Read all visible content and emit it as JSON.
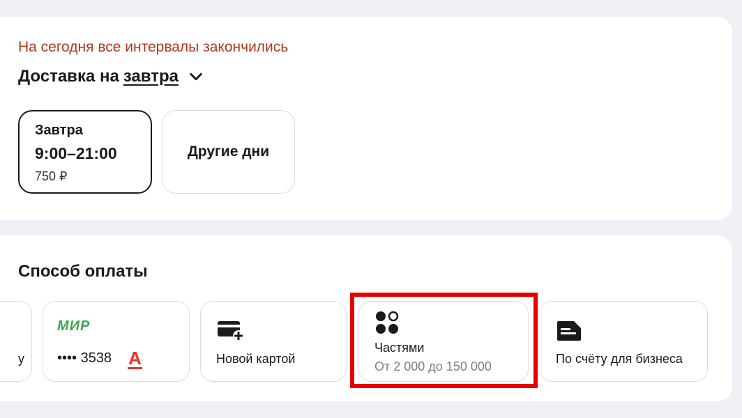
{
  "delivery": {
    "notice": "На сегодня все интервалы закончились",
    "heading_prefix": "Доставка на",
    "heading_link": "завтра",
    "slots": [
      {
        "day": "Завтра",
        "time": "9:00–21:00",
        "price": "750 ₽"
      },
      {
        "label": "Другие дни"
      }
    ]
  },
  "payment": {
    "title": "Способ оплаты",
    "cards": [
      {
        "label": "у"
      },
      {
        "brand": "МИР",
        "number": "•••• 3538",
        "bank_icon": "А"
      },
      {
        "label": "Новой картой",
        "icon": "add-card-icon"
      },
      {
        "label": "Частями",
        "sub": "От 2 000 до 150 000",
        "icon": "dots-icon"
      },
      {
        "label": "По счёту для бизнеса",
        "icon": "invoice-icon"
      }
    ]
  },
  "colors": {
    "notice": "#b0381c",
    "highlight": "#e60000",
    "mir": "#3aa84a",
    "alfa": "#ef3124"
  }
}
